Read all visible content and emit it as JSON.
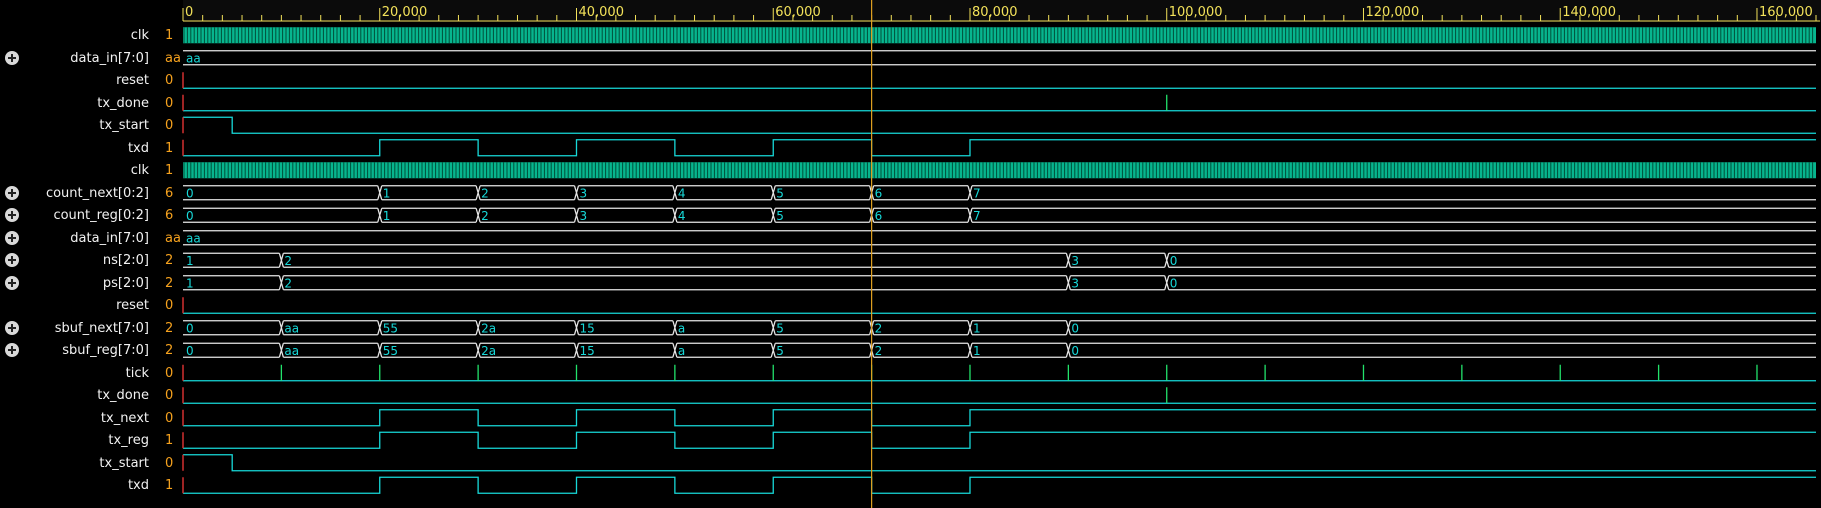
{
  "colors": {
    "background": "#000000",
    "signal_name": "#f2f2f2",
    "signal_value": "#f6a21e",
    "waveform": "#17d9d9",
    "waveform_high": "#22e36b",
    "clock": "#07b58e",
    "bus": "#e6e6e6",
    "ruler_text": "#f3e25a",
    "cursor": "#e0a020"
  },
  "ruler": {
    "labels": [
      "0",
      "20,000",
      "40,000",
      "60,000",
      "80,000",
      "100,000",
      "120,000",
      "140,000",
      "160,000"
    ]
  },
  "cursor": {
    "time": 70000
  },
  "timeline": {
    "time_end": 166000
  },
  "signals": [
    {
      "name": "clk",
      "value": "1",
      "type": "clock",
      "expandable": false
    },
    {
      "name": "data_in[7:0]",
      "value": "aa",
      "type": "bus",
      "expandable": true,
      "segments": [
        {
          "t": 0,
          "label": "aa"
        }
      ]
    },
    {
      "name": "reset",
      "value": "0",
      "type": "bit",
      "expandable": false,
      "transitions": [
        {
          "t": 0,
          "v": 0
        }
      ]
    },
    {
      "name": "tx_done",
      "value": "0",
      "type": "bit",
      "expandable": false,
      "transitions": [
        {
          "t": 0,
          "v": 0
        }
      ],
      "spikes": [
        100000
      ]
    },
    {
      "name": "tx_start",
      "value": "0",
      "type": "bit",
      "expandable": false,
      "transitions": [
        {
          "t": 0,
          "v": 1
        },
        {
          "t": 5000,
          "v": 0
        }
      ]
    },
    {
      "name": "txd",
      "value": "1",
      "type": "bit",
      "expandable": false,
      "transitions": [
        {
          "t": 0,
          "v": 0
        },
        {
          "t": 20000,
          "v": 1
        },
        {
          "t": 30000,
          "v": 0
        },
        {
          "t": 40000,
          "v": 1
        },
        {
          "t": 50000,
          "v": 0
        },
        {
          "t": 60000,
          "v": 1
        },
        {
          "t": 70000,
          "v": 0
        },
        {
          "t": 80000,
          "v": 1
        }
      ]
    },
    {
      "name": "clk",
      "value": "1",
      "type": "clock",
      "expandable": false
    },
    {
      "name": "count_next[0:2]",
      "value": "6",
      "type": "bus",
      "expandable": true,
      "segments": [
        {
          "t": 0,
          "label": "0"
        },
        {
          "t": 20000,
          "label": "1"
        },
        {
          "t": 30000,
          "label": "2"
        },
        {
          "t": 40000,
          "label": "3"
        },
        {
          "t": 50000,
          "label": "4"
        },
        {
          "t": 60000,
          "label": "5"
        },
        {
          "t": 70000,
          "label": "6"
        },
        {
          "t": 80000,
          "label": "7"
        }
      ]
    },
    {
      "name": "count_reg[0:2]",
      "value": "6",
      "type": "bus",
      "expandable": true,
      "segments": [
        {
          "t": 0,
          "label": "0"
        },
        {
          "t": 20000,
          "label": "1"
        },
        {
          "t": 30000,
          "label": "2"
        },
        {
          "t": 40000,
          "label": "3"
        },
        {
          "t": 50000,
          "label": "4"
        },
        {
          "t": 60000,
          "label": "5"
        },
        {
          "t": 70000,
          "label": "6"
        },
        {
          "t": 80000,
          "label": "7"
        }
      ]
    },
    {
      "name": "data_in[7:0]",
      "value": "aa",
      "type": "bus",
      "expandable": true,
      "segments": [
        {
          "t": 0,
          "label": "aa"
        }
      ]
    },
    {
      "name": "ns[2:0]",
      "value": "2",
      "type": "bus",
      "expandable": true,
      "segments": [
        {
          "t": 0,
          "label": "1"
        },
        {
          "t": 10000,
          "label": "2"
        },
        {
          "t": 90000,
          "label": "3"
        },
        {
          "t": 100000,
          "label": "0"
        }
      ]
    },
    {
      "name": "ps[2:0]",
      "value": "2",
      "type": "bus",
      "expandable": true,
      "segments": [
        {
          "t": 0,
          "label": "1"
        },
        {
          "t": 10000,
          "label": "2"
        },
        {
          "t": 90000,
          "label": "3"
        },
        {
          "t": 100000,
          "label": "0"
        }
      ]
    },
    {
      "name": "reset",
      "value": "0",
      "type": "bit",
      "expandable": false,
      "transitions": [
        {
          "t": 0,
          "v": 0
        }
      ]
    },
    {
      "name": "sbuf_next[7:0]",
      "value": "2",
      "type": "bus",
      "expandable": true,
      "segments": [
        {
          "t": 0,
          "label": "0"
        },
        {
          "t": 10000,
          "label": "aa"
        },
        {
          "t": 20000,
          "label": "55"
        },
        {
          "t": 30000,
          "label": "2a"
        },
        {
          "t": 40000,
          "label": "15"
        },
        {
          "t": 50000,
          "label": "a"
        },
        {
          "t": 60000,
          "label": "5"
        },
        {
          "t": 70000,
          "label": "2"
        },
        {
          "t": 80000,
          "label": "1"
        },
        {
          "t": 90000,
          "label": "0"
        }
      ]
    },
    {
      "name": "sbuf_reg[7:0]",
      "value": "2",
      "type": "bus",
      "expandable": true,
      "segments": [
        {
          "t": 0,
          "label": "0"
        },
        {
          "t": 10000,
          "label": "aa"
        },
        {
          "t": 20000,
          "label": "55"
        },
        {
          "t": 30000,
          "label": "2a"
        },
        {
          "t": 40000,
          "label": "15"
        },
        {
          "t": 50000,
          "label": "a"
        },
        {
          "t": 60000,
          "label": "5"
        },
        {
          "t": 70000,
          "label": "2"
        },
        {
          "t": 80000,
          "label": "1"
        },
        {
          "t": 90000,
          "label": "0"
        }
      ]
    },
    {
      "name": "tick",
      "value": "0",
      "type": "bit",
      "expandable": false,
      "transitions": [
        {
          "t": 0,
          "v": 0
        }
      ],
      "spikes": [
        10000,
        20000,
        30000,
        40000,
        50000,
        60000,
        70000,
        80000,
        90000,
        100000,
        110000,
        120000,
        130000,
        140000,
        150000,
        160000
      ]
    },
    {
      "name": "tx_done",
      "value": "0",
      "type": "bit",
      "expandable": false,
      "transitions": [
        {
          "t": 0,
          "v": 0
        }
      ],
      "spikes": [
        100000
      ]
    },
    {
      "name": "tx_next",
      "value": "0",
      "type": "bit",
      "expandable": false,
      "transitions": [
        {
          "t": 0,
          "v": 0
        },
        {
          "t": 20000,
          "v": 1
        },
        {
          "t": 30000,
          "v": 0
        },
        {
          "t": 40000,
          "v": 1
        },
        {
          "t": 50000,
          "v": 0
        },
        {
          "t": 60000,
          "v": 1
        },
        {
          "t": 70000,
          "v": 0
        },
        {
          "t": 80000,
          "v": 1
        }
      ]
    },
    {
      "name": "tx_reg",
      "value": "1",
      "type": "bit",
      "expandable": false,
      "transitions": [
        {
          "t": 0,
          "v": 0
        },
        {
          "t": 20000,
          "v": 1
        },
        {
          "t": 30000,
          "v": 0
        },
        {
          "t": 40000,
          "v": 1
        },
        {
          "t": 50000,
          "v": 0
        },
        {
          "t": 60000,
          "v": 1
        },
        {
          "t": 70000,
          "v": 0
        },
        {
          "t": 80000,
          "v": 1
        }
      ]
    },
    {
      "name": "tx_start",
      "value": "0",
      "type": "bit",
      "expandable": false,
      "transitions": [
        {
          "t": 0,
          "v": 1
        },
        {
          "t": 5000,
          "v": 0
        }
      ]
    },
    {
      "name": "txd",
      "value": "1",
      "type": "bit",
      "expandable": false,
      "transitions": [
        {
          "t": 0,
          "v": 0
        },
        {
          "t": 20000,
          "v": 1
        },
        {
          "t": 30000,
          "v": 0
        },
        {
          "t": 40000,
          "v": 1
        },
        {
          "t": 50000,
          "v": 0
        },
        {
          "t": 60000,
          "v": 1
        },
        {
          "t": 70000,
          "v": 0
        },
        {
          "t": 80000,
          "v": 1
        }
      ]
    }
  ]
}
